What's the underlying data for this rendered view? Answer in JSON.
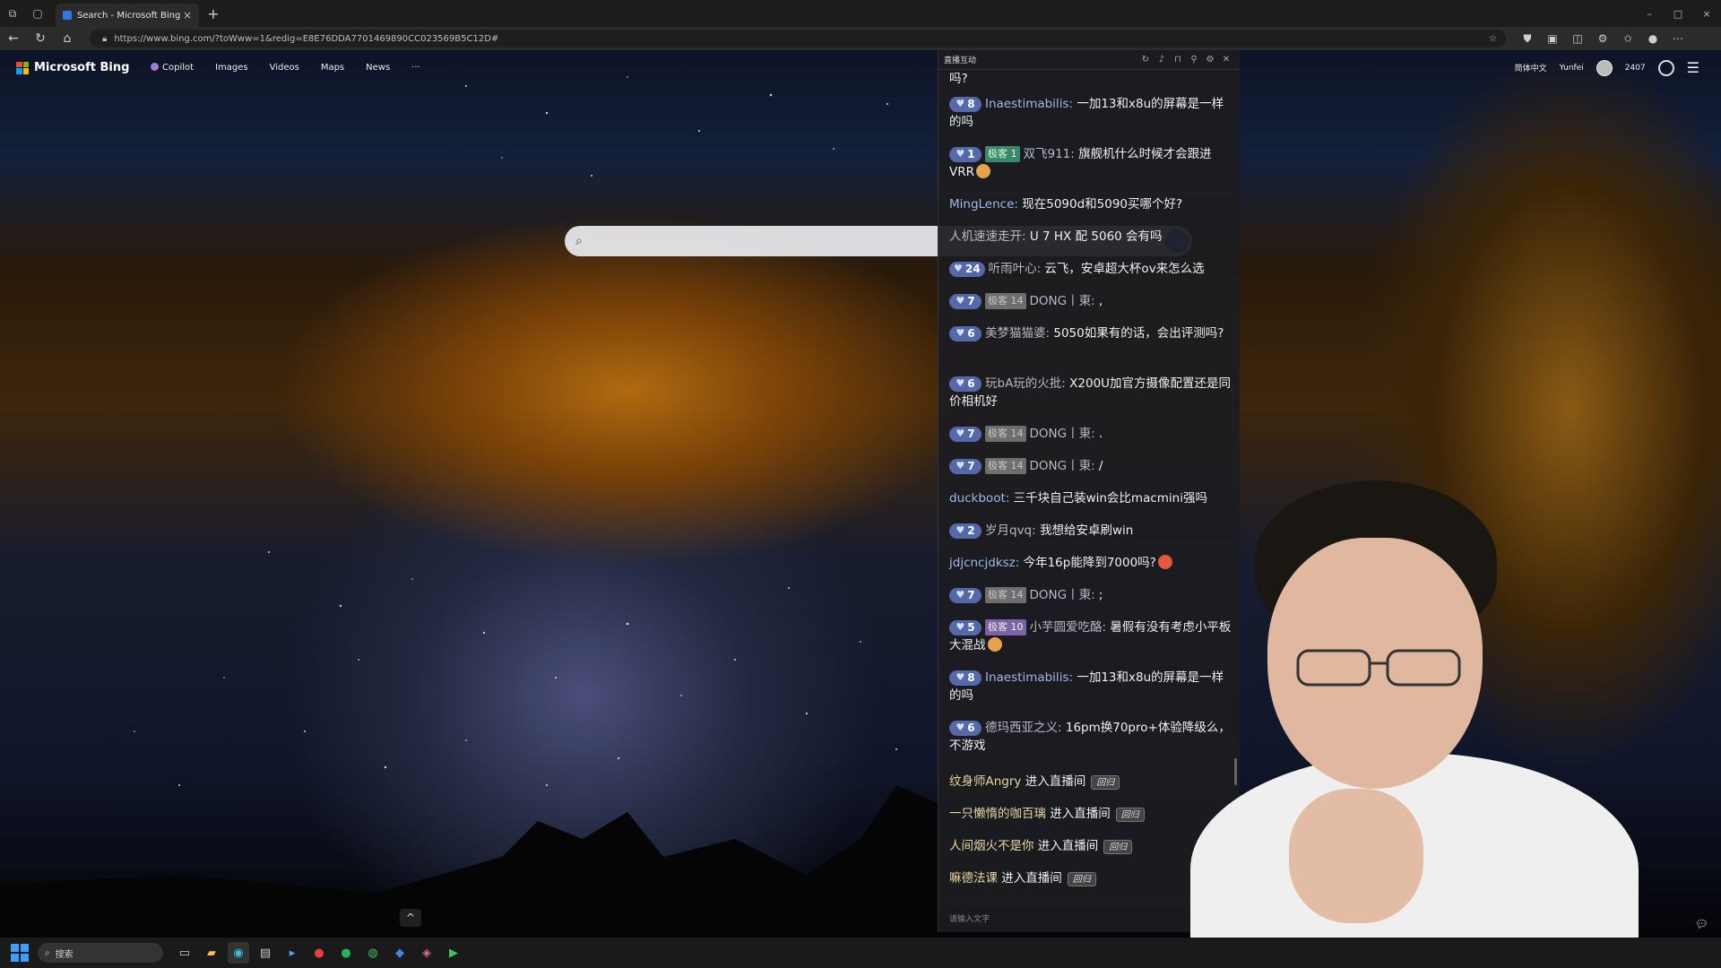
{
  "browser": {
    "tab_title": "Search - Microsoft Bing",
    "tab_close": "×",
    "new_tab": "+",
    "url": "https://www.bing.com/?toWww=1&redig=E8E76DDA7701469890CC023569B5C12D#",
    "window_controls": [
      "–",
      "□",
      "×"
    ]
  },
  "bing": {
    "logo_text": "Microsoft Bing",
    "logo_colors": [
      "#f25022",
      "#7fba00",
      "#00a4ef",
      "#ffb900"
    ],
    "nav": [
      "Copilot",
      "Images",
      "Videos",
      "Maps",
      "News",
      "···"
    ],
    "language": "简体中文",
    "user_name": "Yunfei",
    "rewards_points": "2407",
    "scroll_up": "^"
  },
  "chat": {
    "title": "直播互动",
    "input_placeholder": "请输入文字",
    "messages": [
      {
        "text": "吗?"
      },
      {
        "level": "8",
        "user": "Inaestimabilis:",
        "text": " 一加13和x8u的屏幕是一样的吗"
      },
      {
        "level": "1",
        "badge": "极客 1",
        "user": "双飞911:",
        "text": " 旗舰机什么时候才会跟进VRR"
      },
      {
        "user": "MingLence:",
        "text": " 现在5090d和5090买哪个好?"
      },
      {
        "user": "人机速速走开:",
        "text": " U 7 HX 配 5060 会有吗"
      },
      {
        "level": "24",
        "user": "听雨叶心:",
        "text": " 云飞，安卓超大杯ov来怎么选"
      },
      {
        "level": "7",
        "badge": "极客 14",
        "user": "DONG丨東:",
        "text": " ,"
      },
      {
        "level": "6",
        "user": "美梦猫猫婆:",
        "text": " 5050如果有的话，会出评测吗?"
      },
      {
        "level": "6",
        "user": "玩bA玩的火批:",
        "text": " X200U加官方摄像配置还是同价相机好"
      },
      {
        "level": "7",
        "badge": "极客 14",
        "user": "DONG丨東:",
        "text": " ."
      },
      {
        "level": "7",
        "badge": "极客 14",
        "user": "DONG丨東:",
        "text": " /"
      },
      {
        "user": "duckboot:",
        "text": " 三千块自己装win会比macmini强吗"
      },
      {
        "level": "2",
        "user": "岁月qvq:",
        "text": " 我想给安卓刷win"
      },
      {
        "user": "jdjcncjdksz:",
        "text": " 今年16p能降到7000吗?"
      },
      {
        "level": "7",
        "badge": "极客 14",
        "user": "DONG丨東:",
        "text": " ;"
      },
      {
        "level": "5",
        "badge": "极客 10",
        "user": "小芋圆爱吃酪:",
        "text": " 暑假有没有考虑小平板大混战"
      },
      {
        "level": "8",
        "user": "Inaestimabilis:",
        "text": " 一加13和x8u的屏幕是一样的吗"
      },
      {
        "level": "6",
        "user": "德玛西亚之义:",
        "text": " 16pm换70pro+体验降级么，不游戏"
      }
    ],
    "entries": [
      {
        "user": "纹身师Angry",
        "action": " 进入直播间",
        "tag": "回归"
      },
      {
        "user": "一只懒惰的咖百璃",
        "action": " 进入直播间",
        "tag": "回归"
      },
      {
        "user": "人间烟火不是你",
        "action": " 进入直播间",
        "tag": "回归"
      },
      {
        "user": "嘛德法课",
        "action": " 进入直播间",
        "tag": "回归"
      }
    ]
  },
  "taskbar": {
    "search_placeholder": "搜索"
  }
}
